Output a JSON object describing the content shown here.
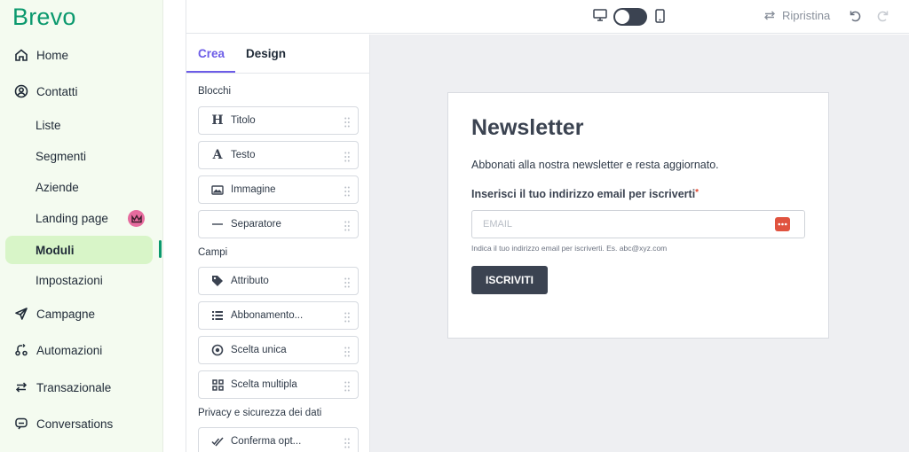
{
  "app": {
    "logo": "Brevo"
  },
  "sidebar": {
    "items": [
      {
        "label": "Home",
        "icon": "home-icon"
      },
      {
        "label": "Contatti",
        "icon": "contacts-icon"
      },
      {
        "label": "Liste"
      },
      {
        "label": "Segmenti"
      },
      {
        "label": "Aziende"
      },
      {
        "label": "Landing page",
        "badge_icon": "crown-icon"
      },
      {
        "label": "Moduli",
        "active": true
      },
      {
        "label": "Impostazioni"
      },
      {
        "label": "Campagne",
        "icon": "send-icon"
      },
      {
        "label": "Automazioni",
        "icon": "automation-icon"
      },
      {
        "label": "Transazionale",
        "icon": "transfer-icon"
      },
      {
        "label": "Conversations",
        "icon": "chat-icon"
      }
    ]
  },
  "toolbar": {
    "restore_label": "Ripristina",
    "view_toggle": "desktop"
  },
  "builder": {
    "tabs": [
      {
        "label": "Crea",
        "active": true
      },
      {
        "label": "Design"
      }
    ],
    "sections": {
      "blocks": "Blocchi",
      "fields": "Campi",
      "privacy": "Privacy e sicurezza dei dati"
    },
    "blocks": [
      {
        "label": "Titolo",
        "icon": "heading-icon"
      },
      {
        "label": "Testo",
        "icon": "text-icon"
      },
      {
        "label": "Immagine",
        "icon": "image-icon"
      },
      {
        "label": "Separatore",
        "icon": "separator-icon"
      }
    ],
    "fields": [
      {
        "label": "Attributo",
        "icon": "tag-icon"
      },
      {
        "label": "Abbonamento...",
        "icon": "list-icon"
      },
      {
        "label": "Scelta unica",
        "icon": "radio-icon"
      },
      {
        "label": "Scelta multipla",
        "icon": "grid-icon"
      }
    ],
    "privacy": [
      {
        "label": "Conferma opt...",
        "icon": "double-check-icon"
      }
    ]
  },
  "form": {
    "title": "Newsletter",
    "description": "Abbonati alla nostra newsletter e resta aggiornato.",
    "email_label": "Inserisci il tuo indirizzo email per iscriverti",
    "required_mark": "*",
    "email_placeholder": "EMAIL",
    "email_value": "",
    "help_text": "Indica il tuo indirizzo email per iscriverti. Es. abc@xyz.com",
    "submit_label": "ISCRIVITI"
  },
  "colors": {
    "brand": "#0b996e",
    "accent": "#6c5ce7",
    "sidebar_bg": "#f4fbf0",
    "active_bg": "#d8f5c8",
    "button_dark": "#3b4351",
    "required": "#e0442c",
    "crown_badge": "#e66b9e"
  }
}
